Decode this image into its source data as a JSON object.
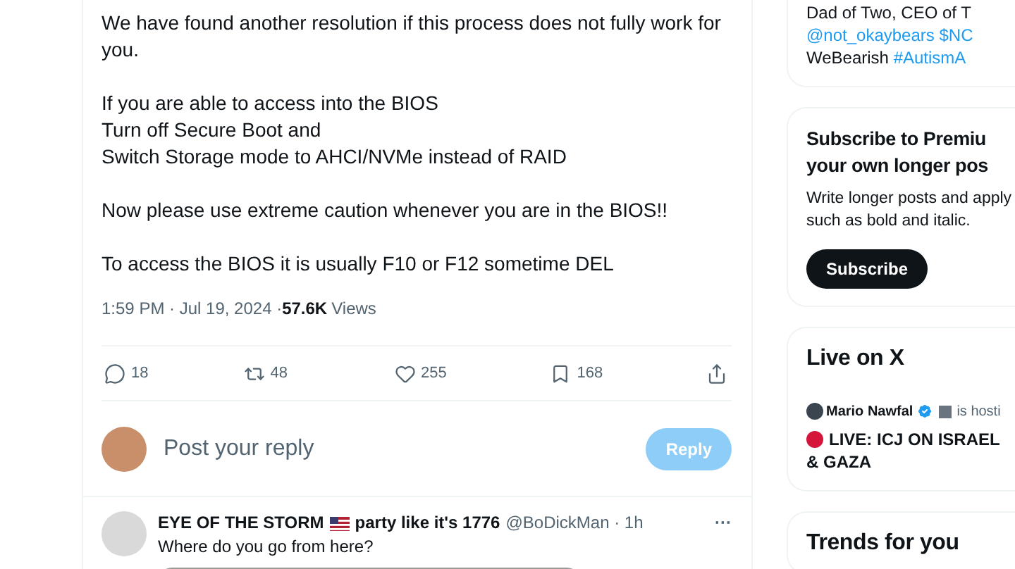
{
  "post": {
    "paragraphs": [
      [
        "We have found another resolution if this process does not fully work for you."
      ],
      [
        "If you are able to access into the BIOS",
        "Turn off Secure Boot and",
        "Switch Storage mode to AHCI/NVMe instead of RAID"
      ],
      [
        "Now please use extreme caution whenever you are in the BIOS!!"
      ],
      [
        "To access the BIOS it is usually F10 or F12 sometime DEL"
      ]
    ],
    "time": "1:59 PM · Jul 19, 2024 · ",
    "views_count": "57.6K",
    "views_label": "Views",
    "actions": [
      {
        "kind": "reply",
        "count": "18"
      },
      {
        "kind": "repost",
        "count": "48"
      },
      {
        "kind": "like",
        "count": "255"
      },
      {
        "kind": "bookmark",
        "count": "168"
      },
      {
        "kind": "share"
      }
    ]
  },
  "composer": {
    "placeholder": "Post your reply",
    "button": "Reply",
    "disabled": true
  },
  "reply": {
    "name": "EYE OF THE STORM",
    "name_suffix": "party like it's 1776",
    "handle": "@BoDickMan · 1h",
    "text": "Where do you go from here?",
    "menu": "···"
  },
  "sidebar": {
    "profile": {
      "bio": [
        {
          "text": "Dad of Two, CEO of T",
          "link": false
        },
        {
          "text": "@not_okaybears $NC",
          "link": true
        },
        {
          "text": "WeBearish ",
          "link": false,
          "tag": "#AutismA"
        }
      ]
    },
    "premium": {
      "title": [
        "Subscribe to Premiu",
        "your own longer pos"
      ],
      "text": [
        "Write longer posts and apply",
        "such as bold and italic."
      ],
      "button": "Subscribe"
    },
    "live": {
      "title": "Live on X",
      "host": "Mario Nawfal",
      "status": "is hosti",
      "event": "LIVE: ICJ ON ISRAEL & GAZA"
    },
    "trends": {
      "title": "Trends for you"
    }
  }
}
